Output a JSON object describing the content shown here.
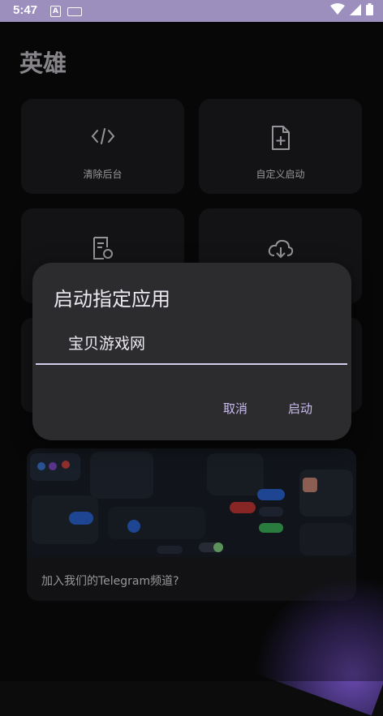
{
  "status_bar": {
    "time": "5:47",
    "icons": [
      "notification-a-icon",
      "keyboard-icon",
      "wifi-icon",
      "signal-icon",
      "battery-icon"
    ]
  },
  "page": {
    "title": "英雄",
    "tiles": [
      {
        "icon": "code-icon",
        "label": "清除后台"
      },
      {
        "icon": "file-plus-icon",
        "label": "自定义启动"
      },
      {
        "icon": "doc-refresh-icon",
        "label": ""
      },
      {
        "icon": "cloud-download-icon",
        "label": ""
      }
    ],
    "banner": {
      "text": "加入我们的Telegram频道?"
    }
  },
  "dialog": {
    "title": "启动指定应用",
    "input_value": "宝贝游戏网",
    "cancel_label": "取消",
    "confirm_label": "启动"
  },
  "colors": {
    "status_bar": "#9c8fbd",
    "background": "#0c0c0d",
    "tile": "#1e1e21",
    "dialog": "#2c2c2f",
    "accent": "#cbbcf2"
  }
}
